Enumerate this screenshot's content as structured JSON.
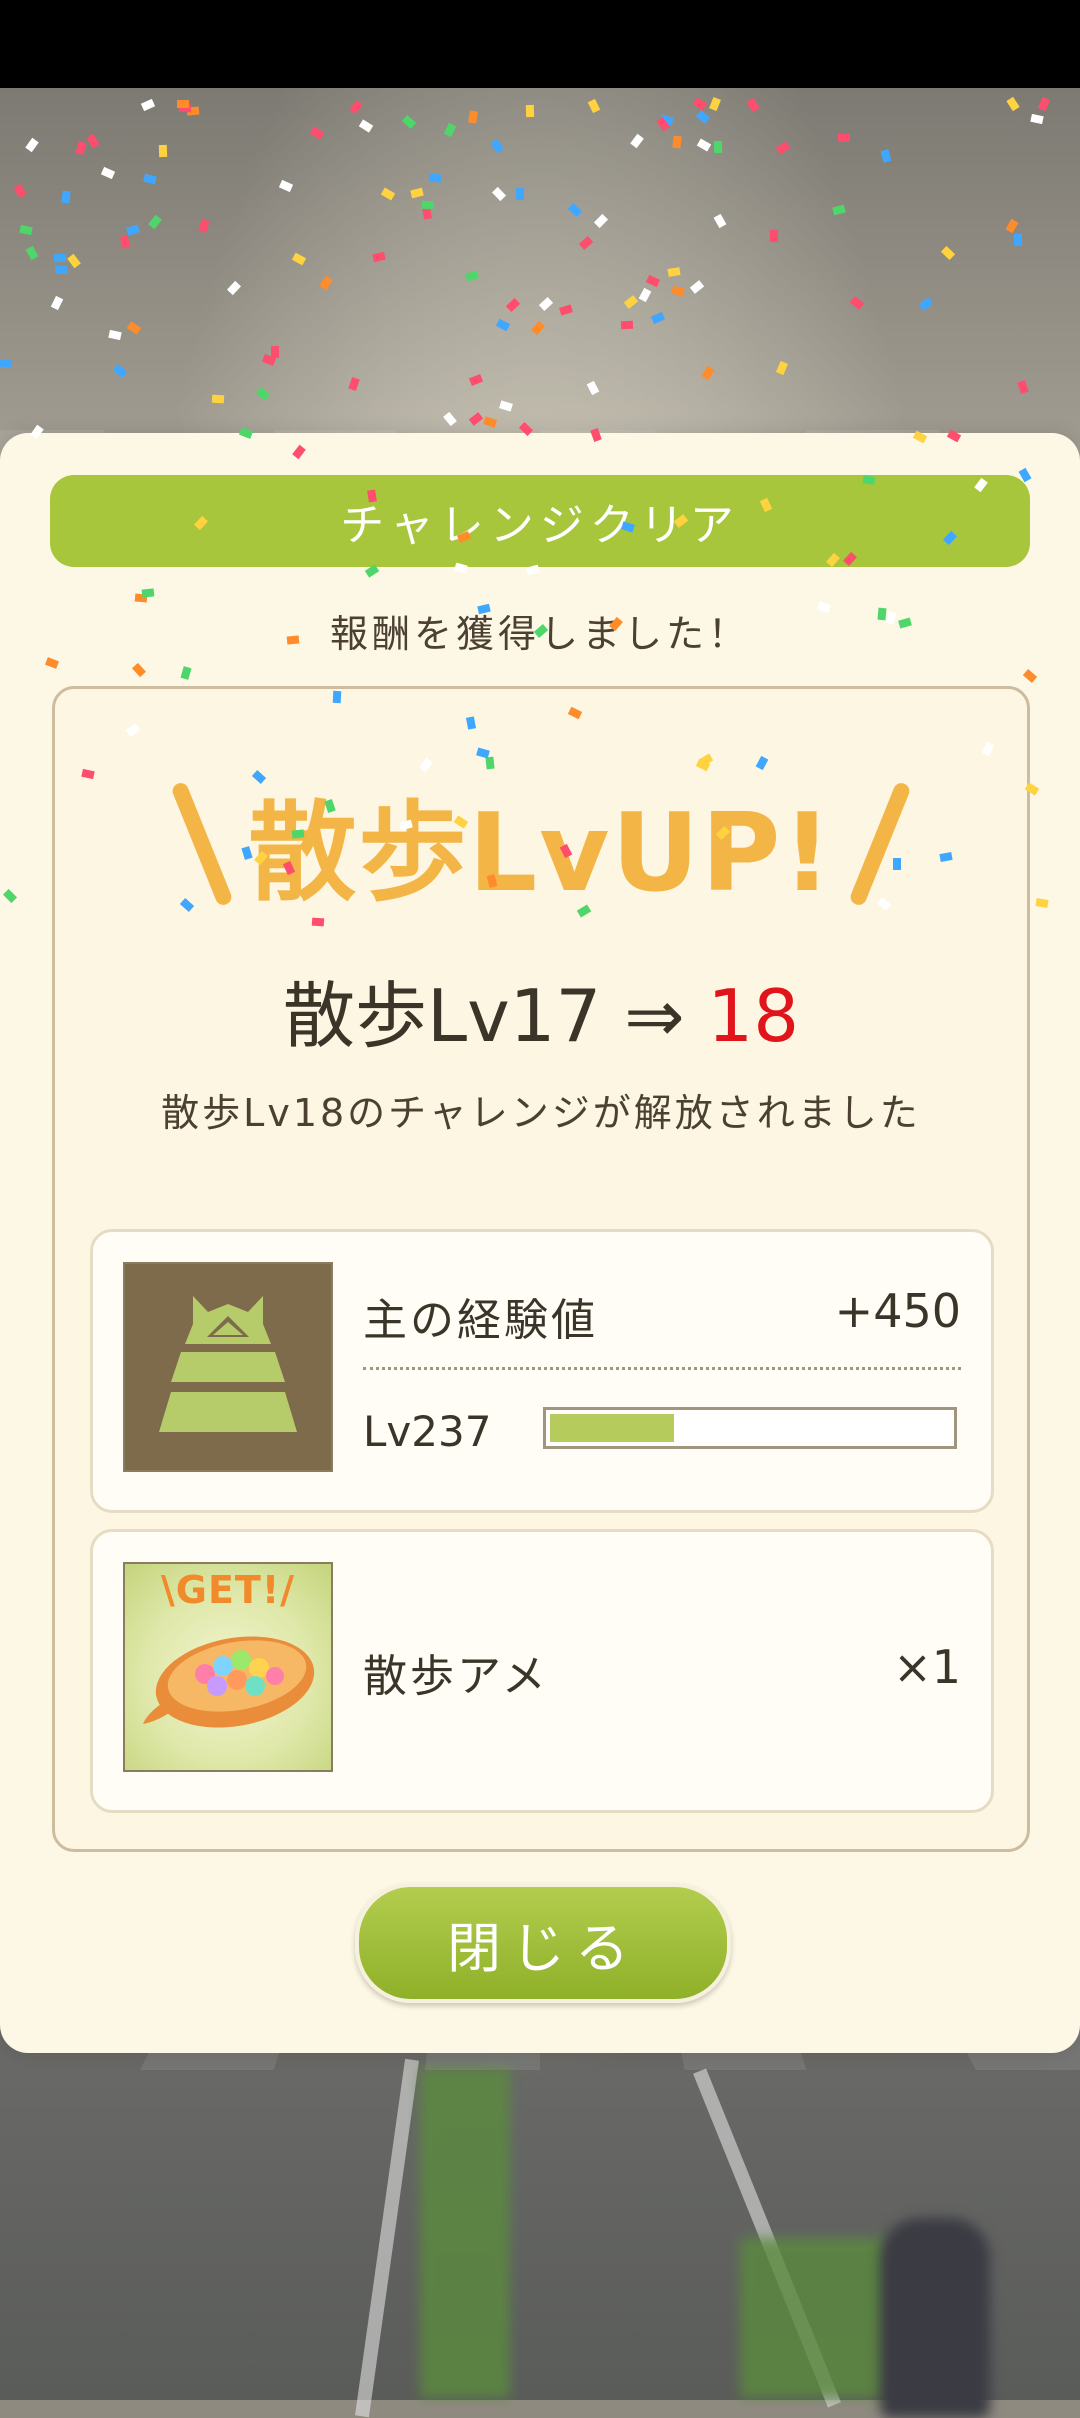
{
  "dialog": {
    "header_title": "チャレンジクリア",
    "reward_message": "報酬を獲得しました！",
    "levelup_banner": "散歩LvUP!",
    "level_change": {
      "prefix": "散歩Lv17",
      "arrow": "⇒",
      "new_level": "18"
    },
    "unlock_message": "散歩Lv18のチャレンジが解放されました",
    "rewards": {
      "exp": {
        "icon": "castle-icon",
        "title": "主の経験値",
        "amount": "+450",
        "level_label": "Lv237",
        "progress_fraction": 0.31
      },
      "item": {
        "icon": "walk-candy-icon",
        "badge": "\\GET!/",
        "name": "散歩アメ",
        "quantity": "×1"
      }
    },
    "close_label": "閉じる"
  },
  "colors": {
    "accent_green": "#a8c63c",
    "levelup_orange": "#f3b646",
    "new_level_red": "#e0141a",
    "dialog_bg": "#fdf8e6"
  }
}
